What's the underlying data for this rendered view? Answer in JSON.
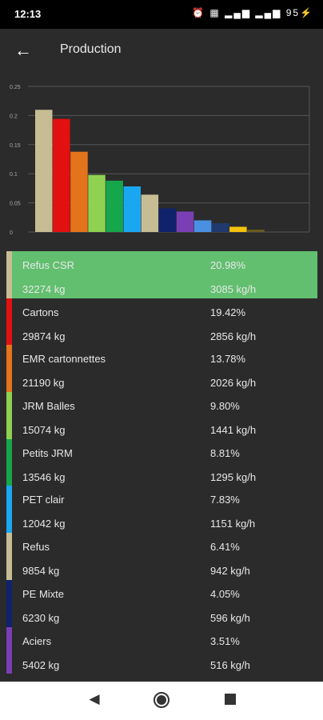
{
  "status": {
    "time": "12:13",
    "battery": "95"
  },
  "header": {
    "title": "Production"
  },
  "chart_data": {
    "type": "bar",
    "categories": [
      "Refus CSR",
      "Cartons",
      "EMR cartonnettes",
      "JRM Balles",
      "Petits JRM",
      "PET clair",
      "Refus",
      "PE Mixte",
      "Aciers",
      "",
      "",
      "",
      ""
    ],
    "values": [
      0.2098,
      0.1942,
      0.1378,
      0.098,
      0.0881,
      0.0783,
      0.0641,
      0.0405,
      0.0351,
      0.02,
      0.015,
      0.009,
      0.004
    ],
    "colors": [
      "#c7bd94",
      "#e21010",
      "#e4741b",
      "#8fd150",
      "#16a64b",
      "#1aa7f2",
      "#c7bd94",
      "#10226c",
      "#7a3eb5",
      "#4a90e2",
      "#203a70",
      "#f4c20d",
      "#6a5a20"
    ],
    "ylim": [
      0,
      0.25
    ],
    "yticks": [
      "0",
      "0.05",
      "0.1",
      "0.15",
      "0.2",
      "0.25"
    ],
    "grid": true
  },
  "items": [
    {
      "name": "Refus CSR",
      "pct": "20.98%",
      "kg": "32274 kg",
      "rate": "3085 kg/h",
      "color": "#c7bd94"
    },
    {
      "name": "Cartons",
      "pct": "19.42%",
      "kg": "29874 kg",
      "rate": "2856 kg/h",
      "color": "#e21010"
    },
    {
      "name": "EMR cartonnettes",
      "pct": "13.78%",
      "kg": "21190 kg",
      "rate": "2026 kg/h",
      "color": "#e4741b"
    },
    {
      "name": "JRM Balles",
      "pct": "9.80%",
      "kg": "15074 kg",
      "rate": "1441 kg/h",
      "color": "#8fd150"
    },
    {
      "name": "Petits JRM",
      "pct": "8.81%",
      "kg": "13546 kg",
      "rate": "1295 kg/h",
      "color": "#16a64b"
    },
    {
      "name": "PET clair",
      "pct": "7.83%",
      "kg": "12042 kg",
      "rate": "1151 kg/h",
      "color": "#1aa7f2"
    },
    {
      "name": "Refus",
      "pct": "6.41%",
      "kg": "9854 kg",
      "rate": "942 kg/h",
      "color": "#c7bd94"
    },
    {
      "name": "PE Mixte",
      "pct": "4.05%",
      "kg": "6230 kg",
      "rate": "596 kg/h",
      "color": "#10226c"
    },
    {
      "name": "Aciers",
      "pct": "3.51%",
      "kg": "5402 kg",
      "rate": "516 kg/h",
      "color": "#7a3eb5"
    }
  ]
}
